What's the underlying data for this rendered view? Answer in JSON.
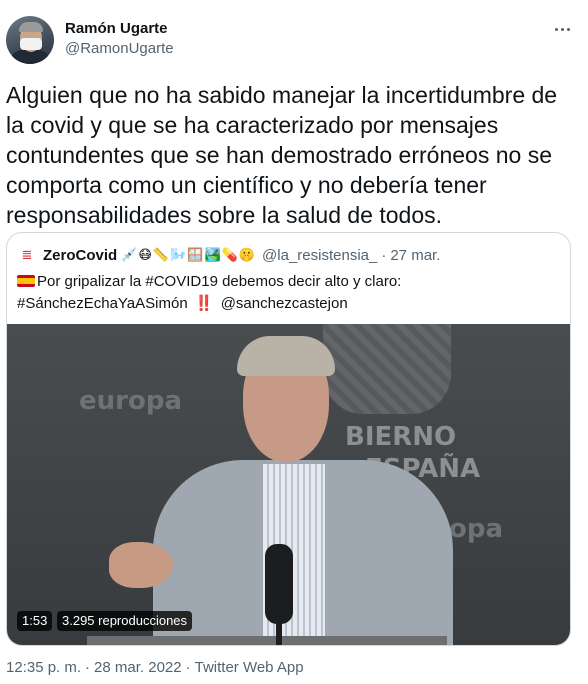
{
  "author": {
    "name": "Ramón Ugarte",
    "handle": "@RamonUgarte"
  },
  "tweet": {
    "text": "Alguien que no ha sabido manejar la incertidumbre de la covid y que se ha caracterizado por mensajes contundentes que se han demostrado erróneos no se comporta como un científico y no debería tener responsabilidades sobre la salud de todos."
  },
  "quoted": {
    "name": "ZeroCovid",
    "emojis": "💉😷📏🌬️🪟🏞️💊🤫",
    "handle": "@la_resistensia_",
    "dot": "·",
    "date": "27 mar.",
    "text_line1": "Por gripalizar la #COVID19 debemos decir alto y claro:",
    "text_line2a": "#SánchezEchaYaASimón",
    "bang": "‼️",
    "mention": "@sanchezcastejon",
    "video": {
      "bg_word_left": "europa",
      "bg_word_right": "europa",
      "bg_word_gob": "BIERNO",
      "bg_word_esp": "ESPAÑA",
      "duration": "1:53",
      "views": "3.295 reproducciones"
    }
  },
  "footer": {
    "time": "12:35 p. m.",
    "sep": "·",
    "date": "28 mar. 2022",
    "source": "Twitter Web App"
  },
  "icons": {
    "more": "more-horizontal-icon",
    "flag": "spain-flag-icon",
    "quoted_avatar": "quoted-avatar-icon"
  },
  "colors": {
    "text": "#0f1419",
    "secondary": "#536471",
    "border": "#cfd9de"
  }
}
